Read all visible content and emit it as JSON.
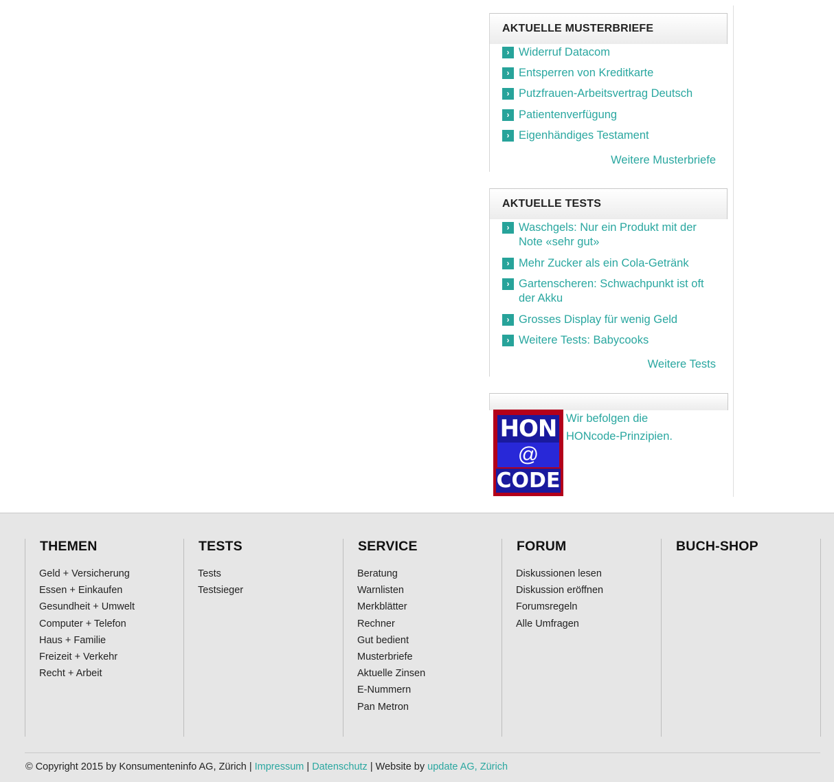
{
  "sidebar": {
    "musterbriefe": {
      "title": "AKTUELLE MUSTERBRIEFE",
      "items": [
        "Widerruf Datacom",
        "Entsperren von Kreditkarte",
        "Putzfrauen-Arbeitsvertrag Deutsch",
        "Patientenverfügung",
        "Eigenhändiges Testament"
      ],
      "more": "Weitere Musterbriefe"
    },
    "tests": {
      "title": "AKTUELLE TESTS",
      "items": [
        "Waschgels: Nur ein Produkt mit der Note «sehr gut»",
        "Mehr Zucker als ein Cola-Getränk",
        "Gartenscheren: Schwachpunkt ist oft der Akku",
        "Grosses Display für wenig Geld",
        "Weitere Tests: Babycooks"
      ],
      "more": "Weitere Tests"
    },
    "hon": {
      "logo_top": "HON",
      "logo_mid": "@",
      "logo_bottom": "CODE",
      "text": "Wir befolgen die HONcode-Prinzipien."
    },
    "accent_color": "#2aa7a0",
    "arrow_icon": "chevron-right-icon"
  },
  "footer": {
    "columns": [
      {
        "title": "THEMEN",
        "items": [
          "Geld + Versicherung",
          "Essen + Einkaufen",
          "Gesundheit + Umwelt",
          "Computer + Telefon",
          "Haus + Familie",
          "Freizeit + Verkehr",
          "Recht + Arbeit"
        ]
      },
      {
        "title": "TESTS",
        "items": [
          "Tests",
          "Testsieger"
        ]
      },
      {
        "title": "SERVICE",
        "items": [
          "Beratung",
          "Warnlisten",
          "Merkblätter",
          "Rechner",
          "Gut bedient",
          "Musterbriefe",
          "Aktuelle Zinsen",
          "E-Nummern",
          "Pan Metron"
        ]
      },
      {
        "title": "FORUM",
        "items": [
          "Diskussionen lesen",
          "Diskussion eröffnen",
          "Forumsregeln",
          "Alle Umfragen"
        ]
      },
      {
        "title": "BUCH-SHOP",
        "items": []
      }
    ],
    "copyright": {
      "prefix": "© Copyright 2015 by Konsumenteninfo AG, Zürich |",
      "impressum": "Impressum",
      "sep1": "|",
      "datenschutz": "Datenschutz",
      "sep2": "| Website by",
      "update": "update AG, Zürich"
    }
  }
}
